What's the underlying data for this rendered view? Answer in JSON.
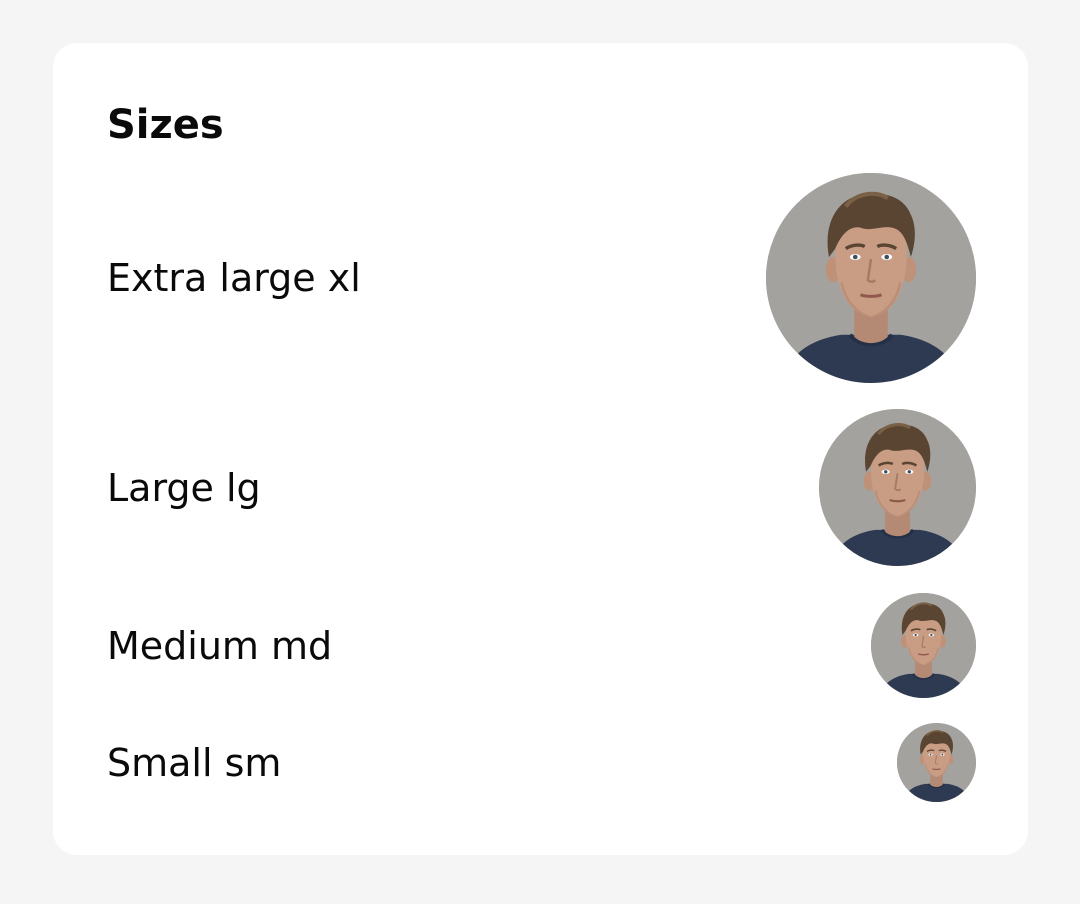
{
  "card": {
    "title": "Sizes"
  },
  "avatar_rows": [
    {
      "label": "Extra large xl",
      "size": "xl",
      "image": "person-portrait"
    },
    {
      "label": "Large lg",
      "size": "lg",
      "image": "person-portrait"
    },
    {
      "label": "Medium md",
      "size": "md",
      "image": "person-portrait"
    },
    {
      "label": "Small sm",
      "size": "sm",
      "image": "person-portrait"
    }
  ],
  "colors": {
    "page_background": "#f5f5f5",
    "card_background": "#ffffff",
    "text": "#0a0a0a",
    "avatar_background": "#a09f9b",
    "shirt": "#2e3a52",
    "hair": "#5a4532",
    "skin": "#c99c84"
  }
}
